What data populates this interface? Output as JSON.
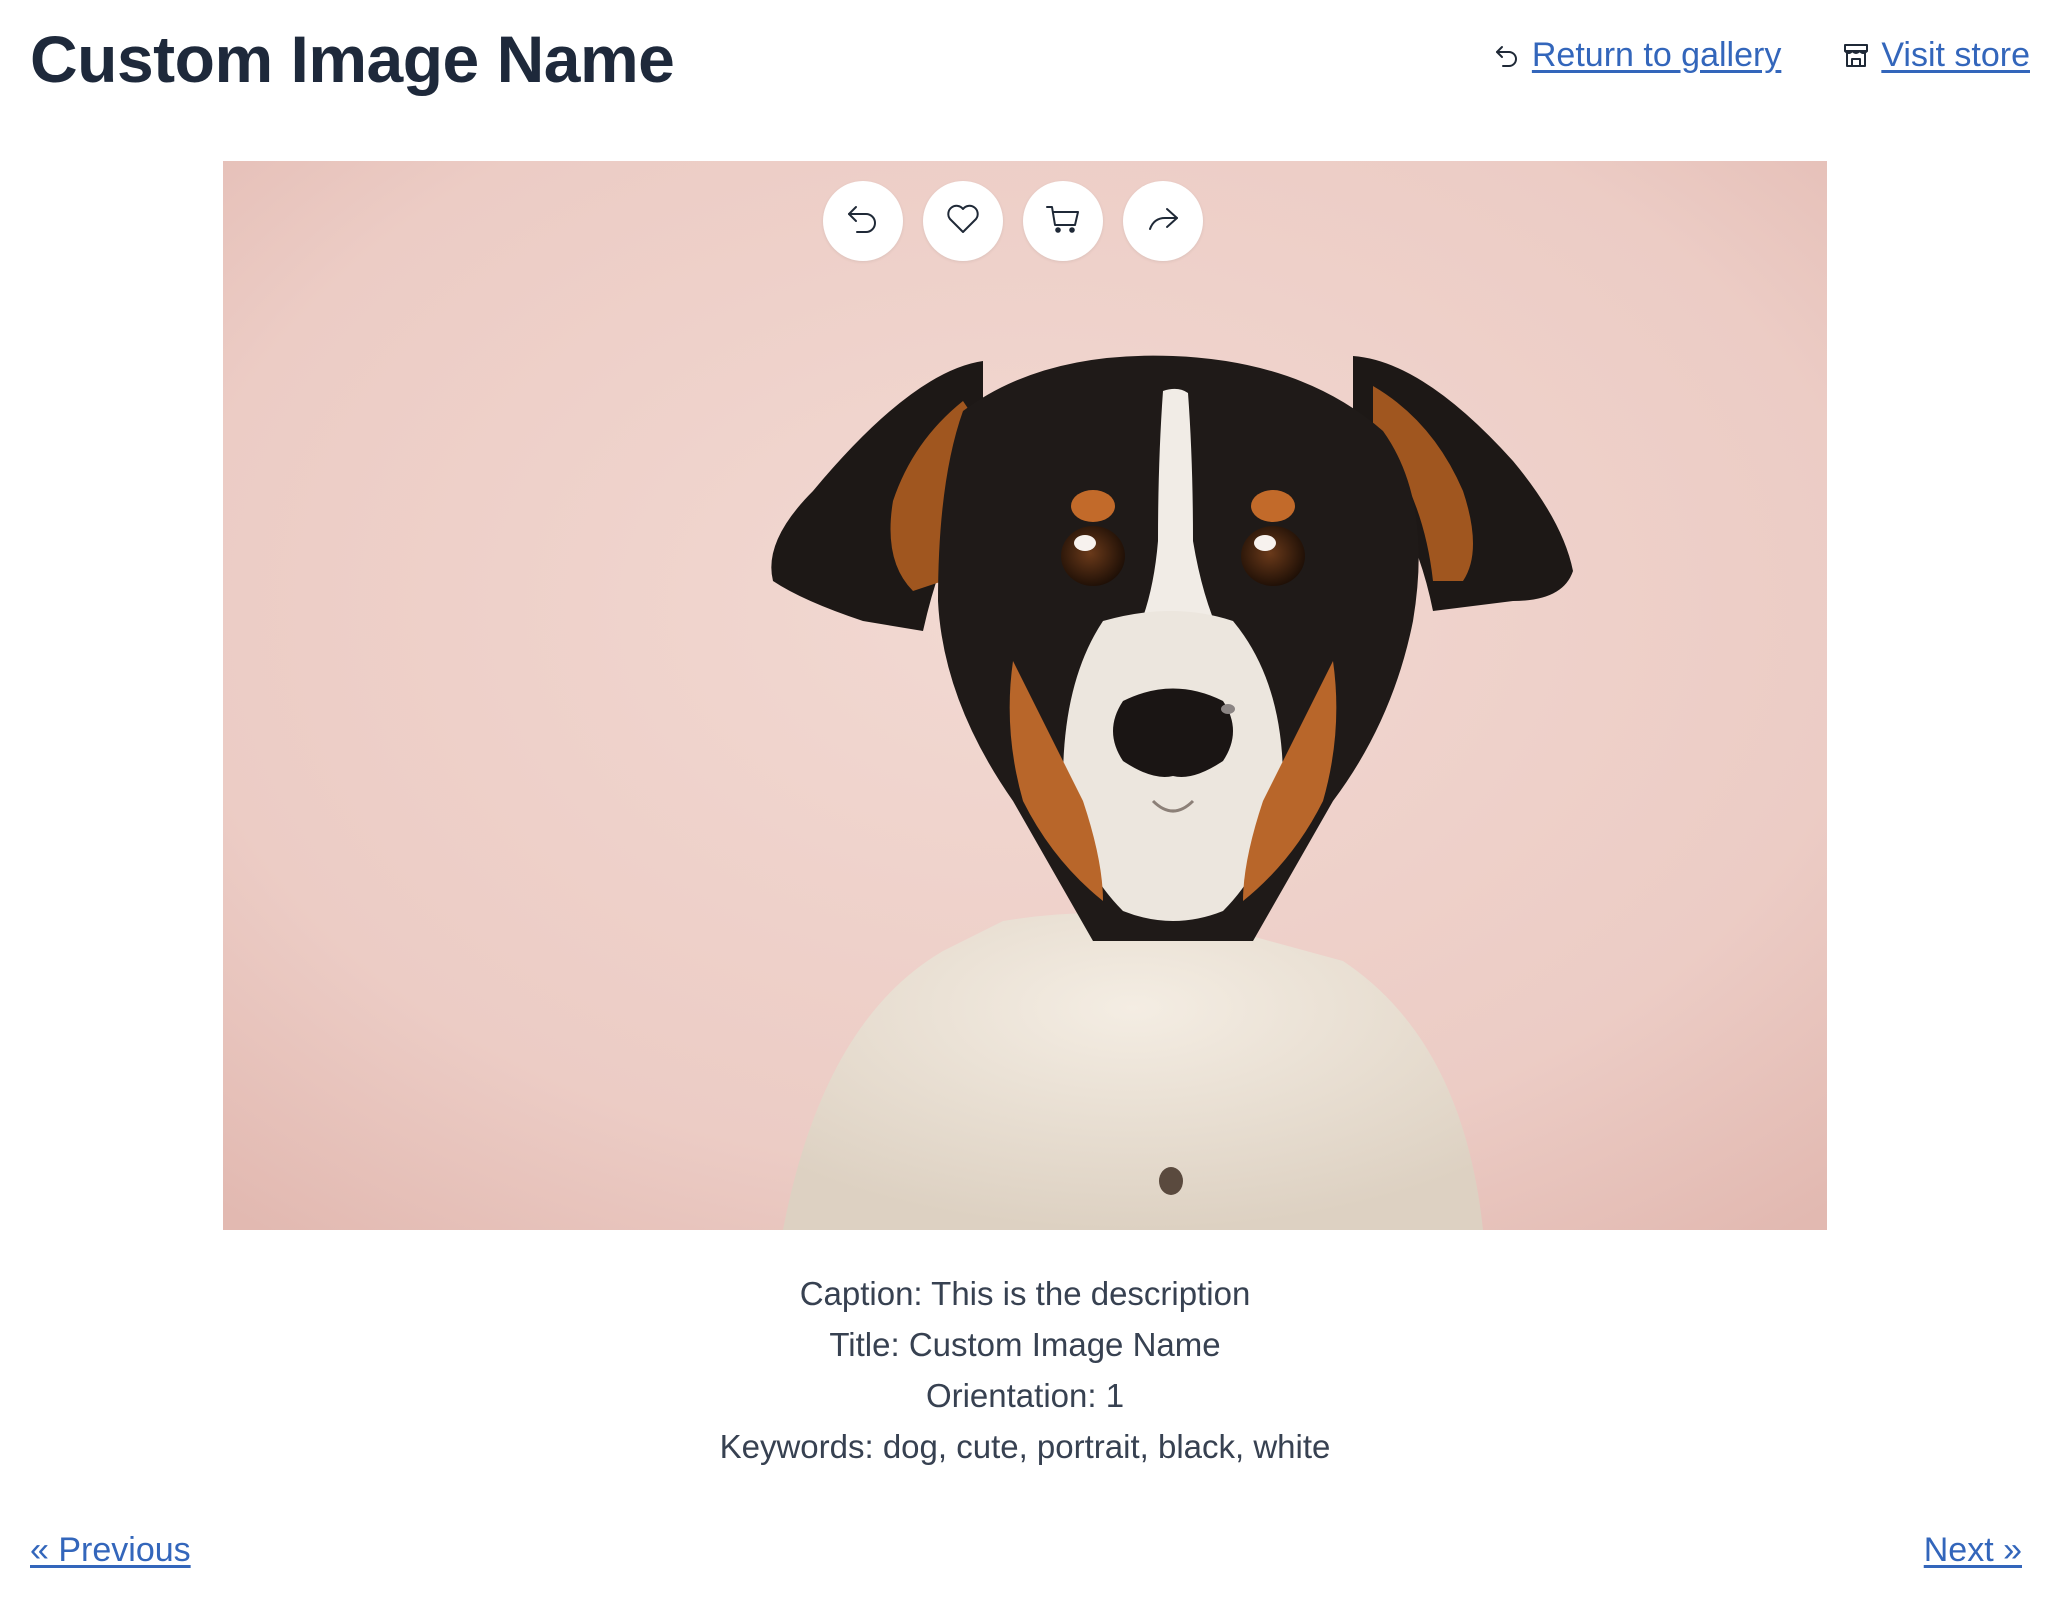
{
  "header": {
    "title": "Custom Image Name",
    "nav": {
      "return_label": "Return to gallery",
      "return_icon": "return-icon",
      "store_label": "Visit store",
      "store_icon": "store-icon"
    }
  },
  "viewer": {
    "image_subject": "dog-portrait",
    "background_color": "#efd3cc",
    "actions": [
      {
        "name": "back-button",
        "icon": "undo-icon"
      },
      {
        "name": "favorite-button",
        "icon": "heart-icon"
      },
      {
        "name": "cart-button",
        "icon": "cart-icon"
      },
      {
        "name": "share-button",
        "icon": "share-icon"
      }
    ]
  },
  "metadata": {
    "caption": "Caption: This is the description",
    "title": "Title: Custom Image Name",
    "orientation": "Orientation: 1",
    "keywords": "Keywords: dog, cute, portrait, black, white"
  },
  "pager": {
    "previous_label": "« Previous",
    "next_label": "Next »"
  },
  "colors": {
    "link": "#3366bb",
    "heading": "#1e293b",
    "body_text": "#374151"
  }
}
